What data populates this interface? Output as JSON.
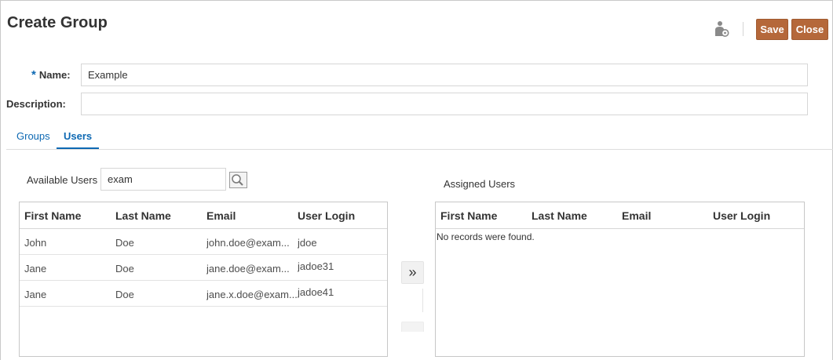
{
  "header": {
    "title": "Create Group",
    "user_icon": "user-settings-icon",
    "save_label": "Save",
    "close_label": "Close",
    "button_color": "#b5683a"
  },
  "form": {
    "name_required_marker": "*",
    "name_label": "Name:",
    "name_value": "Example",
    "description_label": "Description:",
    "description_value": ""
  },
  "tabs": [
    {
      "label": "Groups",
      "selected": false
    },
    {
      "label": "Users",
      "selected": true
    }
  ],
  "available": {
    "label": "Available Users",
    "search_value": "exam",
    "search_icon": "magnifier-icon",
    "columns": [
      "First Name",
      "Last Name",
      "Email",
      "User Login"
    ],
    "rows": [
      {
        "first": "John",
        "last": "Doe",
        "email": "john.doe@exam...",
        "login": "jdoe"
      },
      {
        "first": "Jane",
        "last": "Doe",
        "email": "jane.doe@exam...",
        "login": "jadoe31"
      },
      {
        "first": "Jane",
        "last": "Doe",
        "email": "jane.x.doe@exam...",
        "login": "jadoe41"
      }
    ]
  },
  "move": {
    "move_right_label": "»",
    "move_right_icon": "double-chevron-right-icon"
  },
  "assigned": {
    "label": "Assigned Users",
    "columns": [
      "First Name",
      "Last Name",
      "Email",
      "User Login"
    ],
    "empty_text": "No records were found."
  },
  "colors": {
    "accent": "#0e69b3",
    "button": "#b5683a"
  }
}
